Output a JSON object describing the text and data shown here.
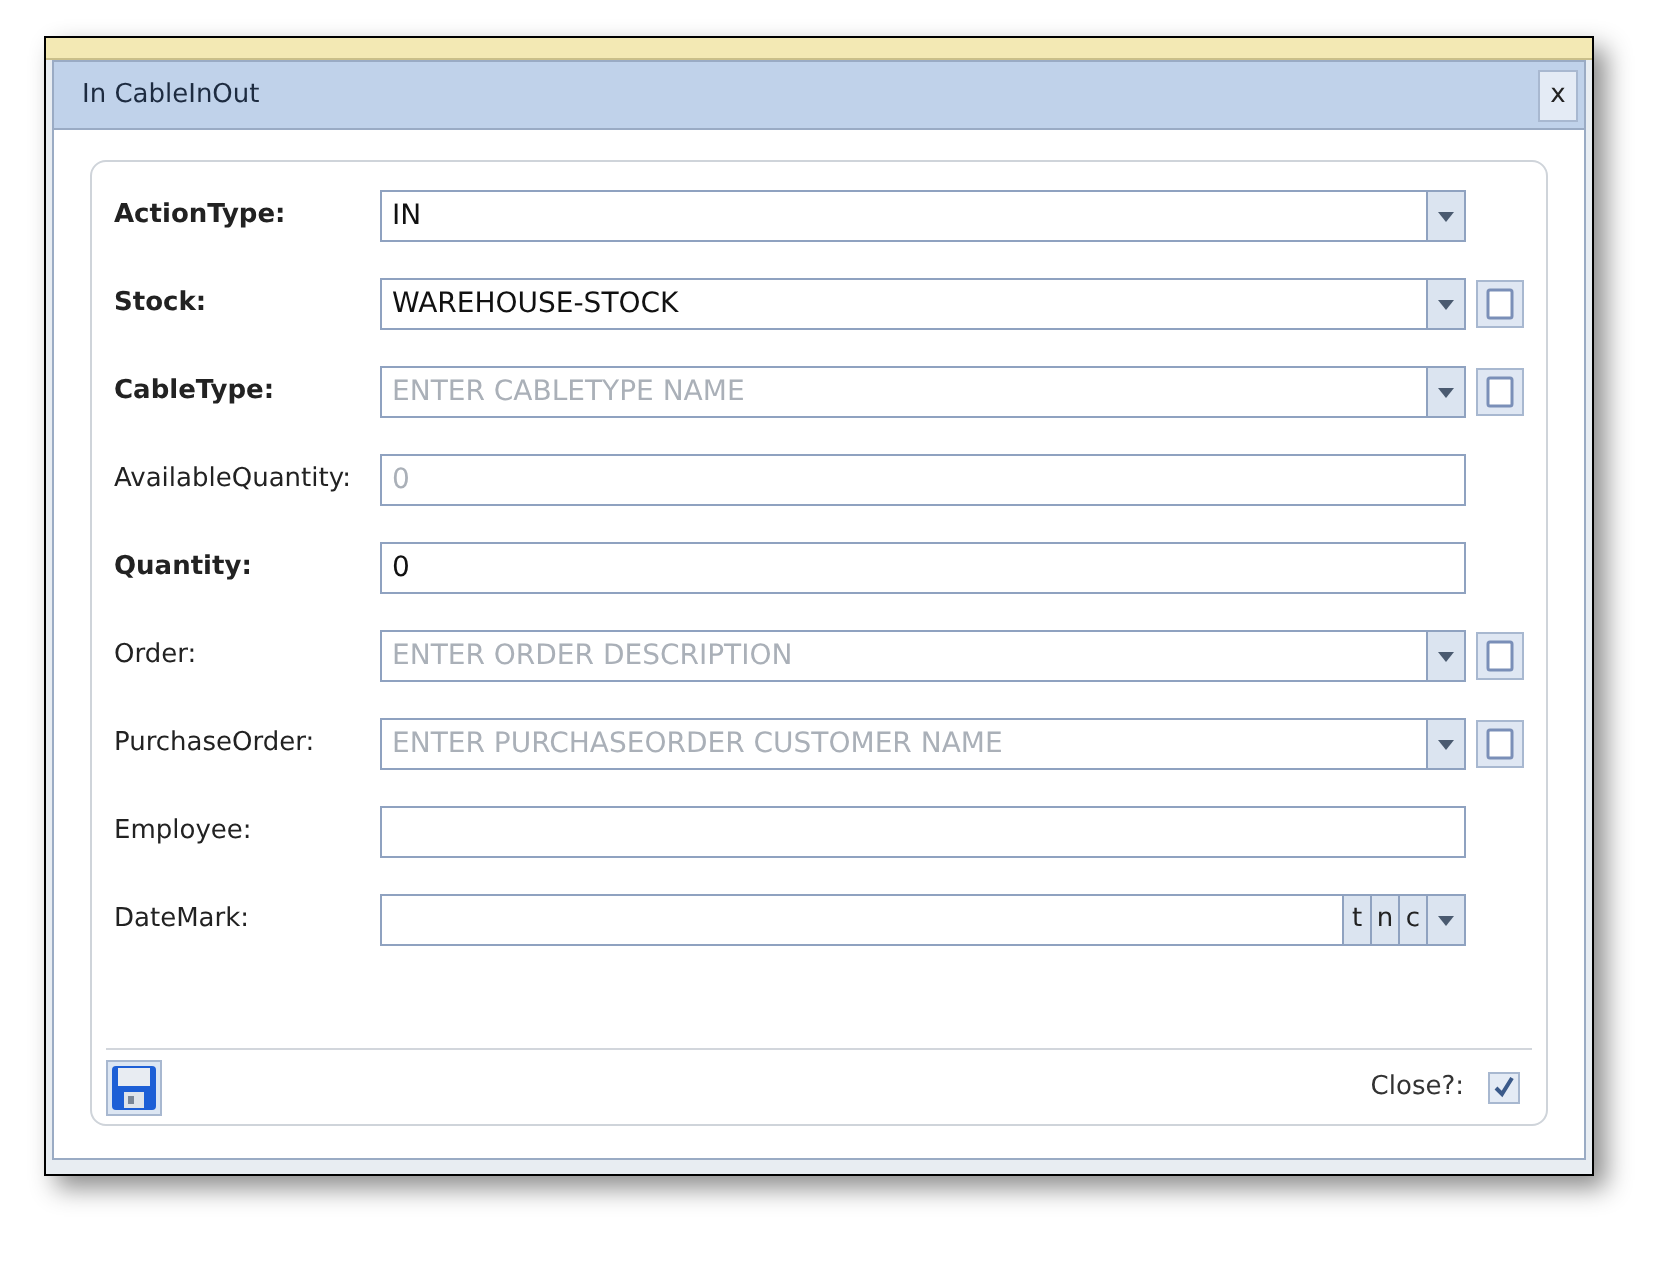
{
  "dialog": {
    "title": "In CableInOut",
    "close_button": "x"
  },
  "fields": [
    {
      "label": "ActionType:",
      "bold": true,
      "kind": "select",
      "value": "IN"
    },
    {
      "label": "Stock:",
      "bold": true,
      "kind": "select_add",
      "value": "WAREHOUSE-STOCK"
    },
    {
      "label": "CableType:",
      "bold": true,
      "kind": "select_add",
      "placeholder": "ENTER CABLETYPE NAME"
    },
    {
      "label": "AvailableQuantity:",
      "bold": false,
      "kind": "text",
      "placeholder": "0"
    },
    {
      "label": "Quantity:",
      "bold": true,
      "kind": "text",
      "value": "0"
    },
    {
      "label": "Order:",
      "bold": false,
      "kind": "select_add",
      "placeholder": "ENTER ORDER DESCRIPTION"
    },
    {
      "label": "PurchaseOrder:",
      "bold": false,
      "kind": "select_add",
      "placeholder": "ENTER PURCHASEORDER CUSTOMER NAME"
    },
    {
      "label": "Employee:",
      "bold": false,
      "kind": "text"
    },
    {
      "label": "DateMark:",
      "bold": false,
      "kind": "date",
      "buttons": [
        "t",
        "n",
        "c"
      ]
    }
  ],
  "footer": {
    "close_label": "Close?:",
    "close_checked": true
  }
}
